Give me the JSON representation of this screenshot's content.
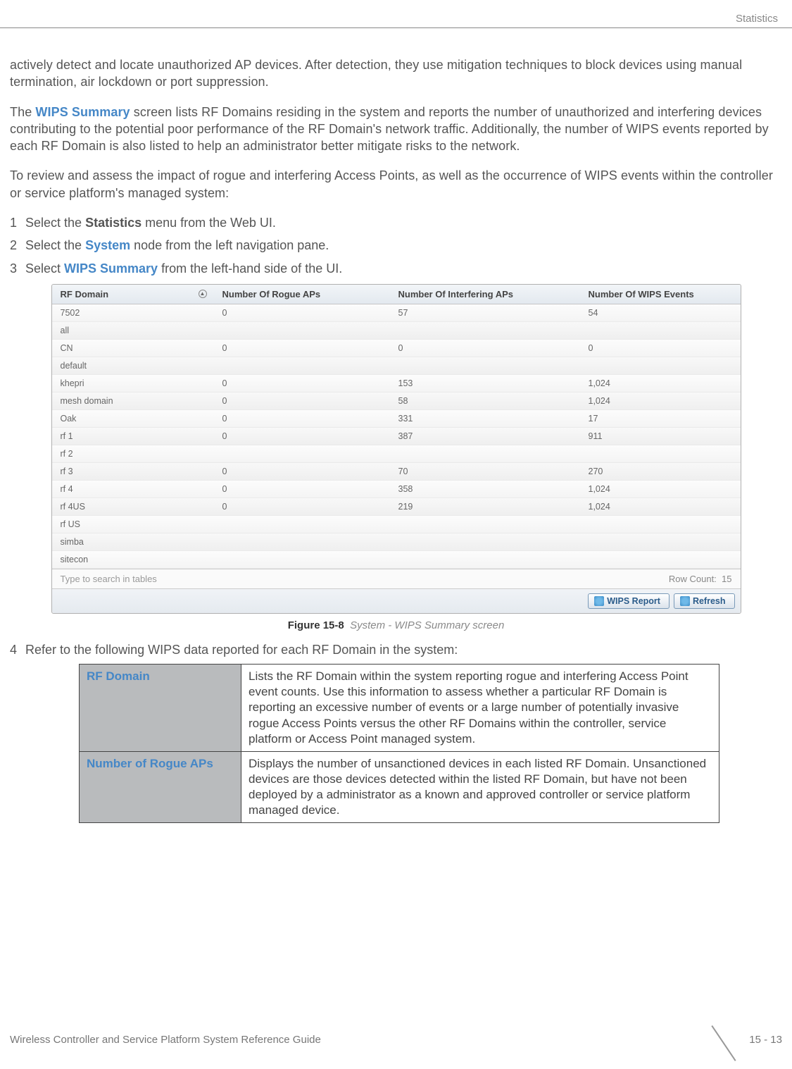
{
  "header": {
    "section": "Statistics"
  },
  "body": {
    "p1": "actively detect and locate unauthorized AP devices. After detection, they use mitigation techniques to block devices using manual termination, air lockdown or port suppression.",
    "p2_prefix": "The ",
    "p2_link": "WIPS Summary",
    "p2_rest": " screen lists RF Domains residing in the system and reports the number of unauthorized and interfering devices contributing to the potential poor performance of the RF Domain's network traffic. Additionally, the number of WIPS events reported by each RF Domain is also listed to help an administrator better mitigate risks to the network.",
    "p3": "To review and assess the impact of rogue and interfering Access Points, as well as the occurrence of WIPS events within the controller or service platform's managed system:",
    "steps": [
      {
        "num": "1",
        "pre": "Select the ",
        "bold": "Statistics",
        "post": " menu from the Web UI."
      },
      {
        "num": "2",
        "pre": "Select the ",
        "bold": "System",
        "post": " node from the left navigation pane."
      },
      {
        "num": "3",
        "pre": "Select ",
        "bold": "WIPS Summary",
        "post": " from the left-hand side of the UI."
      }
    ],
    "step4": {
      "num": "4",
      "text": "Refer to the following WIPS data reported for each RF Domain in the system:"
    }
  },
  "screenshot": {
    "columns": {
      "domain": "RF Domain",
      "rogue": "Number Of Rogue APs",
      "interfering": "Number Of Interfering APs",
      "events": "Number Of WIPS Events"
    },
    "rows": [
      {
        "domain": "7502",
        "rogue": "0",
        "interfering": "57",
        "events": "54"
      },
      {
        "domain": "all",
        "rogue": "",
        "interfering": "",
        "events": ""
      },
      {
        "domain": "CN",
        "rogue": "0",
        "interfering": "0",
        "events": "0"
      },
      {
        "domain": "default",
        "rogue": "",
        "interfering": "",
        "events": ""
      },
      {
        "domain": "khepri",
        "rogue": "0",
        "interfering": "153",
        "events": "1,024"
      },
      {
        "domain": "mesh domain",
        "rogue": "0",
        "interfering": "58",
        "events": "1,024"
      },
      {
        "domain": "Oak",
        "rogue": "0",
        "interfering": "331",
        "events": "17"
      },
      {
        "domain": "rf 1",
        "rogue": "0",
        "interfering": "387",
        "events": "911"
      },
      {
        "domain": "rf 2",
        "rogue": "",
        "interfering": "",
        "events": ""
      },
      {
        "domain": "rf 3",
        "rogue": "0",
        "interfering": "70",
        "events": "270"
      },
      {
        "domain": "rf 4",
        "rogue": "0",
        "interfering": "358",
        "events": "1,024"
      },
      {
        "domain": "rf 4US",
        "rogue": "0",
        "interfering": "219",
        "events": "1,024"
      },
      {
        "domain": "rf US",
        "rogue": "",
        "interfering": "",
        "events": ""
      },
      {
        "domain": "simba",
        "rogue": "",
        "interfering": "",
        "events": ""
      },
      {
        "domain": "sitecon",
        "rogue": "",
        "interfering": "",
        "events": ""
      }
    ],
    "search_placeholder": "Type to search in tables",
    "row_count_label": "Row Count:",
    "row_count_value": "15",
    "btn_report": "WIPS Report",
    "btn_refresh": "Refresh"
  },
  "figure": {
    "label": "Figure 15-8",
    "title": "System - WIPS Summary screen"
  },
  "chart_data": {
    "type": "table",
    "columns": [
      "RF Domain",
      "Number Of Rogue APs",
      "Number Of Interfering APs",
      "Number Of WIPS Events"
    ],
    "rows": [
      [
        "7502",
        0,
        57,
        54
      ],
      [
        "all",
        null,
        null,
        null
      ],
      [
        "CN",
        0,
        0,
        0
      ],
      [
        "default",
        null,
        null,
        null
      ],
      [
        "khepri",
        0,
        153,
        1024
      ],
      [
        "mesh domain",
        0,
        58,
        1024
      ],
      [
        "Oak",
        0,
        331,
        17
      ],
      [
        "rf 1",
        0,
        387,
        911
      ],
      [
        "rf 2",
        null,
        null,
        null
      ],
      [
        "rf 3",
        0,
        70,
        270
      ],
      [
        "rf 4",
        0,
        358,
        1024
      ],
      [
        "rf 4US",
        0,
        219,
        1024
      ],
      [
        "rf US",
        null,
        null,
        null
      ],
      [
        "simba",
        null,
        null,
        null
      ],
      [
        "sitecon",
        null,
        null,
        null
      ]
    ],
    "row_count": 15
  },
  "desc_table": [
    {
      "key": "RF Domain",
      "val": "Lists the RF Domain within the system reporting rogue and interfering Access Point event counts. Use this information to assess whether a particular RF Domain is reporting an excessive number of events or a large number of potentially invasive rogue Access Points versus the other RF Domains within the controller, service platform or Access Point managed system."
    },
    {
      "key": "Number of Rogue APs",
      "val": "Displays the number of unsanctioned devices in each listed RF Domain. Unsanctioned devices are those devices detected within the listed RF Domain, but have not been deployed by a administrator as a known and approved controller or service platform managed device."
    }
  ],
  "footer": {
    "guide": "Wireless Controller and Service Platform System Reference Guide",
    "page": "15 - 13"
  }
}
